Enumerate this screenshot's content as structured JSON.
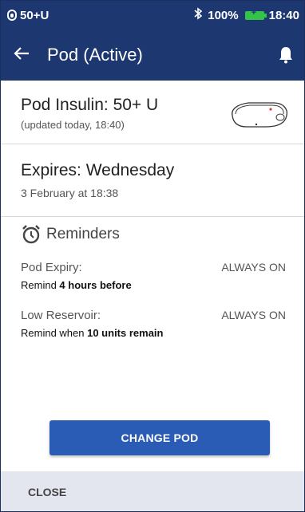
{
  "status_bar": {
    "pod_status": "50+U",
    "battery": "100%",
    "time": "18:40",
    "bluetooth_icon": "bluetooth-icon",
    "battery_icon": "battery-charging-icon"
  },
  "header": {
    "title": "Pod (Active)",
    "back_icon": "back-arrow-icon",
    "notification_icon": "bell-icon"
  },
  "insulin": {
    "title": "Pod Insulin: 50+ U",
    "updated": "(updated today, 18:40)"
  },
  "expires": {
    "title": "Expires: Wednesday",
    "date": "3 February at 18:38"
  },
  "reminders": {
    "title": "Reminders",
    "items": [
      {
        "name": "Pod Expiry:",
        "status": "ALWAYS ON",
        "desc_prefix": "Remind ",
        "desc_bold": "4 hours before",
        "desc_suffix": ""
      },
      {
        "name": "Low Reservoir:",
        "status": "ALWAYS ON",
        "desc_prefix": "Remind when ",
        "desc_bold": "10 units remain",
        "desc_suffix": ""
      }
    ]
  },
  "actions": {
    "change_pod": "CHANGE POD",
    "close": "CLOSE"
  },
  "colors": {
    "header_bg": "#1d3770",
    "button_bg": "#2a5bb5",
    "bottom_bar_bg": "#e4e6ef"
  }
}
